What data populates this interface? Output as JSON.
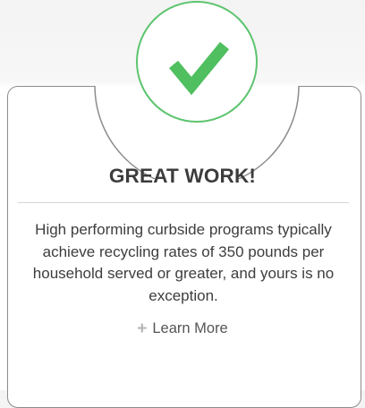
{
  "badge": {
    "icon": "checkmark-icon",
    "ring_color": "#5cc46e",
    "check_color": "#4fbf5f"
  },
  "card": {
    "title": "GREAT WORK!",
    "message": "High performing curbside programs typically achieve recycling rates of 350 pounds per household served or greater, and yours is no exception.",
    "learn_more_icon": "plus-icon",
    "learn_more_label": "Learn More"
  }
}
